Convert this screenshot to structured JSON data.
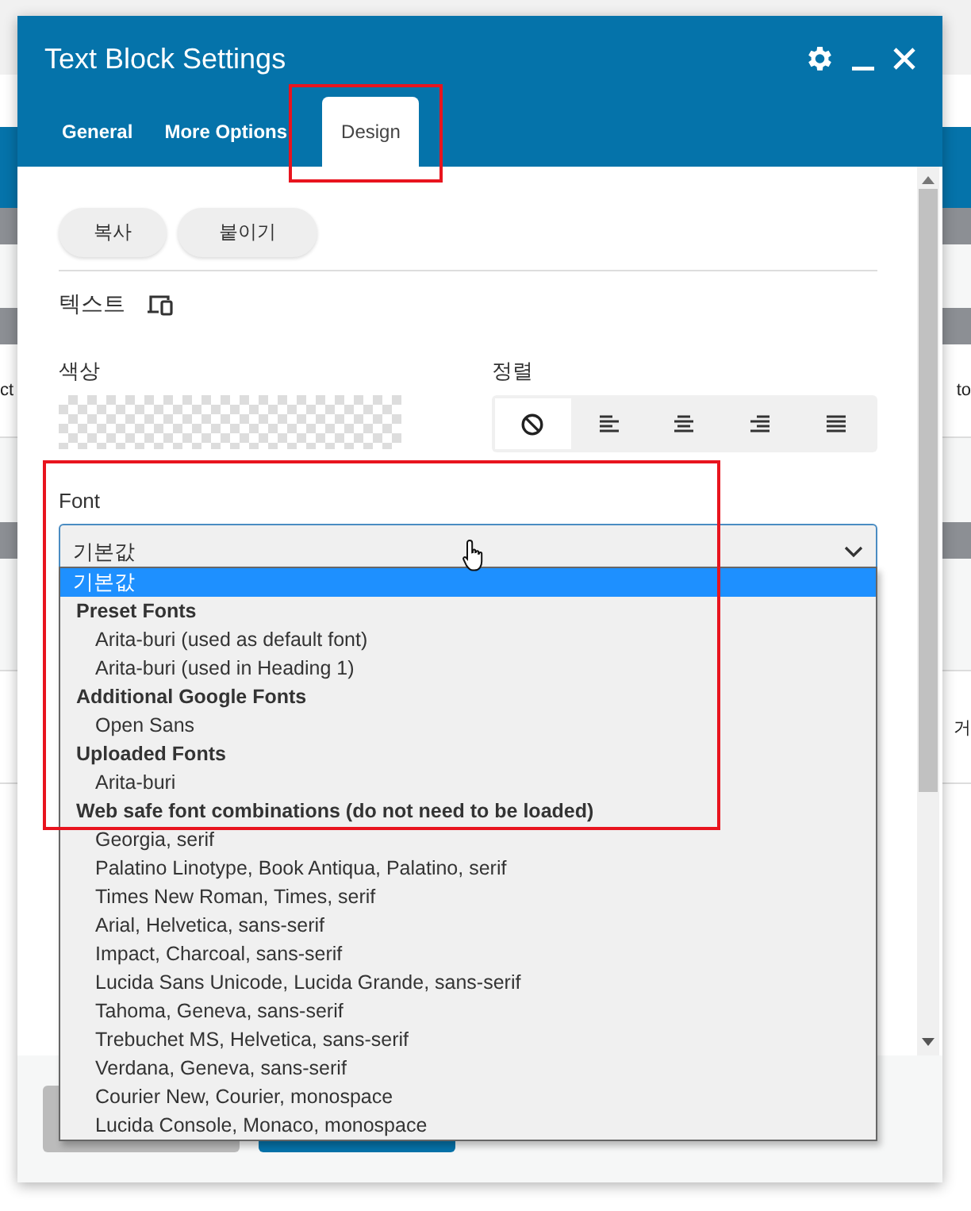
{
  "background": {
    "rows": [
      {
        "left": "ct",
        "right": "to"
      },
      {
        "right": "거"
      }
    ]
  },
  "window": {
    "title": "Text Block Settings"
  },
  "tabs": [
    {
      "label": "General",
      "selected": false
    },
    {
      "label": "More Options",
      "selected": false
    },
    {
      "label": "Design",
      "selected": true
    }
  ],
  "actions": [
    "복사",
    "붙이기"
  ],
  "section": {
    "title": "텍스트"
  },
  "color": {
    "label": "색상"
  },
  "alignment": {
    "label": "정렬",
    "options": [
      {
        "kind": "none",
        "selected": true
      },
      {
        "kind": "left",
        "selected": false
      },
      {
        "kind": "center",
        "selected": false
      },
      {
        "kind": "right",
        "selected": false
      },
      {
        "kind": "justify",
        "selected": false
      }
    ]
  },
  "font": {
    "label": "Font",
    "value": "기본값",
    "options": [
      {
        "kind": "option",
        "label": "기본값",
        "selected": true
      },
      {
        "kind": "group",
        "label": "Preset Fonts"
      },
      {
        "kind": "option",
        "label": "Arita-buri (used as default font)",
        "selected": false
      },
      {
        "kind": "option",
        "label": "Arita-buri (used in Heading 1)",
        "selected": false
      },
      {
        "kind": "group",
        "label": "Additional Google Fonts"
      },
      {
        "kind": "option",
        "label": "Open Sans",
        "selected": false
      },
      {
        "kind": "group",
        "label": "Uploaded Fonts"
      },
      {
        "kind": "option",
        "label": "Arita-buri",
        "selected": false
      },
      {
        "kind": "group",
        "label": "Web safe font combinations (do not need to be loaded)"
      },
      {
        "kind": "option",
        "label": "Georgia, serif",
        "selected": false
      },
      {
        "kind": "option",
        "label": "Palatino Linotype, Book Antiqua, Palatino, serif",
        "selected": false
      },
      {
        "kind": "option",
        "label": "Times New Roman, Times, serif",
        "selected": false
      },
      {
        "kind": "option",
        "label": "Arial, Helvetica, sans-serif",
        "selected": false
      },
      {
        "kind": "option",
        "label": "Impact, Charcoal, sans-serif",
        "selected": false
      },
      {
        "kind": "option",
        "label": "Lucida Sans Unicode, Lucida Grande, sans-serif",
        "selected": false
      },
      {
        "kind": "option",
        "label": "Tahoma, Geneva, sans-serif",
        "selected": false
      },
      {
        "kind": "option",
        "label": "Trebuchet MS, Helvetica, sans-serif",
        "selected": false
      },
      {
        "kind": "option",
        "label": "Verdana, Geneva, sans-serif",
        "selected": false
      },
      {
        "kind": "option",
        "label": "Courier New, Courier, monospace",
        "selected": false
      },
      {
        "kind": "option",
        "label": "Lucida Console, Monaco, monospace",
        "selected": false
      }
    ]
  }
}
